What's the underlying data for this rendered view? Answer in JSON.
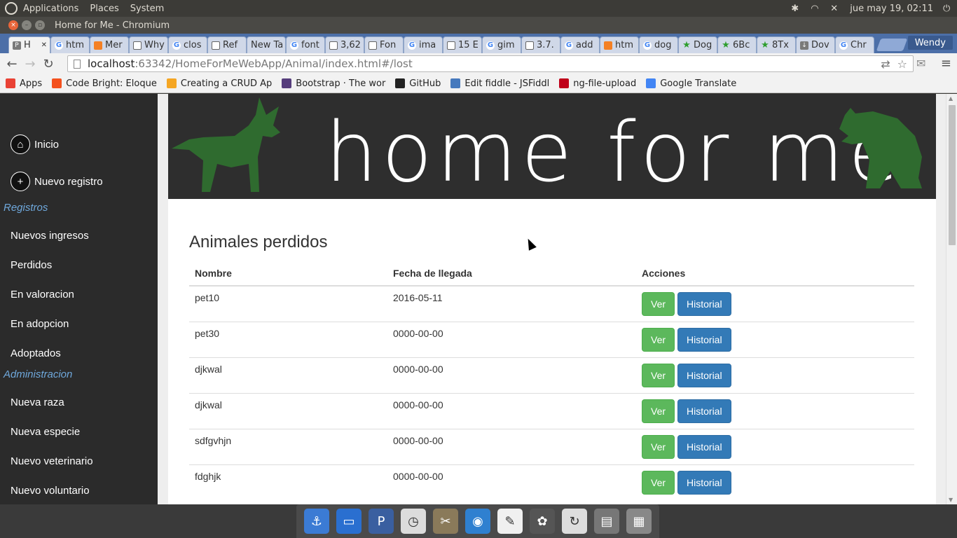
{
  "system_panel": {
    "menus": [
      "Applications",
      "Places",
      "System"
    ],
    "clock": "jue may 19, 02:11"
  },
  "window": {
    "title": "Home for Me - Chromium"
  },
  "tabs": [
    {
      "label": "H",
      "icon": "php-icon",
      "active": true
    },
    {
      "label": "htm",
      "icon": "google-icon"
    },
    {
      "label": "Mer",
      "icon": "stackoverflow-icon"
    },
    {
      "label": "Why",
      "icon": "doc-icon"
    },
    {
      "label": "clos",
      "icon": "google-icon"
    },
    {
      "label": "Ref",
      "icon": "doc-icon"
    },
    {
      "label": "New Ta",
      "icon": ""
    },
    {
      "label": "font",
      "icon": "google-icon"
    },
    {
      "label": "3,62",
      "icon": "doc-icon"
    },
    {
      "label": "Fon",
      "icon": "doc-icon"
    },
    {
      "label": "ima",
      "icon": "google-icon"
    },
    {
      "label": "15 E",
      "icon": "doc-icon"
    },
    {
      "label": "gim",
      "icon": "google-icon"
    },
    {
      "label": "3.7.",
      "icon": "doc-icon"
    },
    {
      "label": "add",
      "icon": "google-icon"
    },
    {
      "label": "htm",
      "icon": "stackoverflow-icon"
    },
    {
      "label": "dog",
      "icon": "google-icon"
    },
    {
      "label": "Dog",
      "icon": "star-icon"
    },
    {
      "label": "6Bc",
      "icon": "star-icon"
    },
    {
      "label": "8Tx",
      "icon": "star-icon"
    },
    {
      "label": "Dov",
      "icon": "download-icon"
    },
    {
      "label": "Chr",
      "icon": "google-icon"
    }
  ],
  "profile_name": "Wendy",
  "address": {
    "host": "localhost",
    "rest": ":63342/HomeForMeWebApp/Animal/index.html#/lost"
  },
  "bookmarks": [
    {
      "label": "Apps",
      "color": "#e94235"
    },
    {
      "label": "Code Bright: Eloque",
      "color": "#f4511e"
    },
    {
      "label": "Creating a CRUD Ap",
      "color": "#f5a623"
    },
    {
      "label": "Bootstrap · The wor",
      "color": "#563d7c"
    },
    {
      "label": "GitHub",
      "color": "#222222"
    },
    {
      "label": "Edit fiddle - JSFiddl",
      "color": "#4679bd"
    },
    {
      "label": "ng-file-upload",
      "color": "#c0001a"
    },
    {
      "label": "Google Translate",
      "color": "#4285f4"
    }
  ],
  "sidebar": {
    "home": "Inicio",
    "new_record": "Nuevo registro",
    "section_records": "Registros",
    "records_items": [
      "Nuevos ingresos",
      "Perdidos",
      "En valoracion",
      "En adopcion",
      "Adoptados"
    ],
    "section_admin": "Administracion",
    "admin_items": [
      "Nueva raza",
      "Nueva especie",
      "Nuevo veterinario",
      "Nuevo voluntario"
    ]
  },
  "banner": {
    "logo_text": "home for me",
    "silhouette_color": "#2f6b2f"
  },
  "main": {
    "heading": "Animales perdidos",
    "columns": [
      "Nombre",
      "Fecha de llegada",
      "Acciones"
    ],
    "view_label": "Ver",
    "history_label": "Historial",
    "rows": [
      {
        "name": "pet10",
        "date": "2016-05-11"
      },
      {
        "name": "pet30",
        "date": "0000-00-00"
      },
      {
        "name": "djkwal",
        "date": "0000-00-00"
      },
      {
        "name": "djkwal",
        "date": "0000-00-00"
      },
      {
        "name": "sdfgvhjn",
        "date": "0000-00-00"
      },
      {
        "name": "fdghjk",
        "date": "0000-00-00"
      }
    ]
  },
  "dock_apps": [
    "anchor-icon",
    "window-icon",
    "phpstorm-icon",
    "clock-icon",
    "tools-icon",
    "chromium-icon",
    "document-viewer-icon",
    "gimp-icon",
    "update-icon",
    "scanner-icon",
    "archive-icon"
  ]
}
